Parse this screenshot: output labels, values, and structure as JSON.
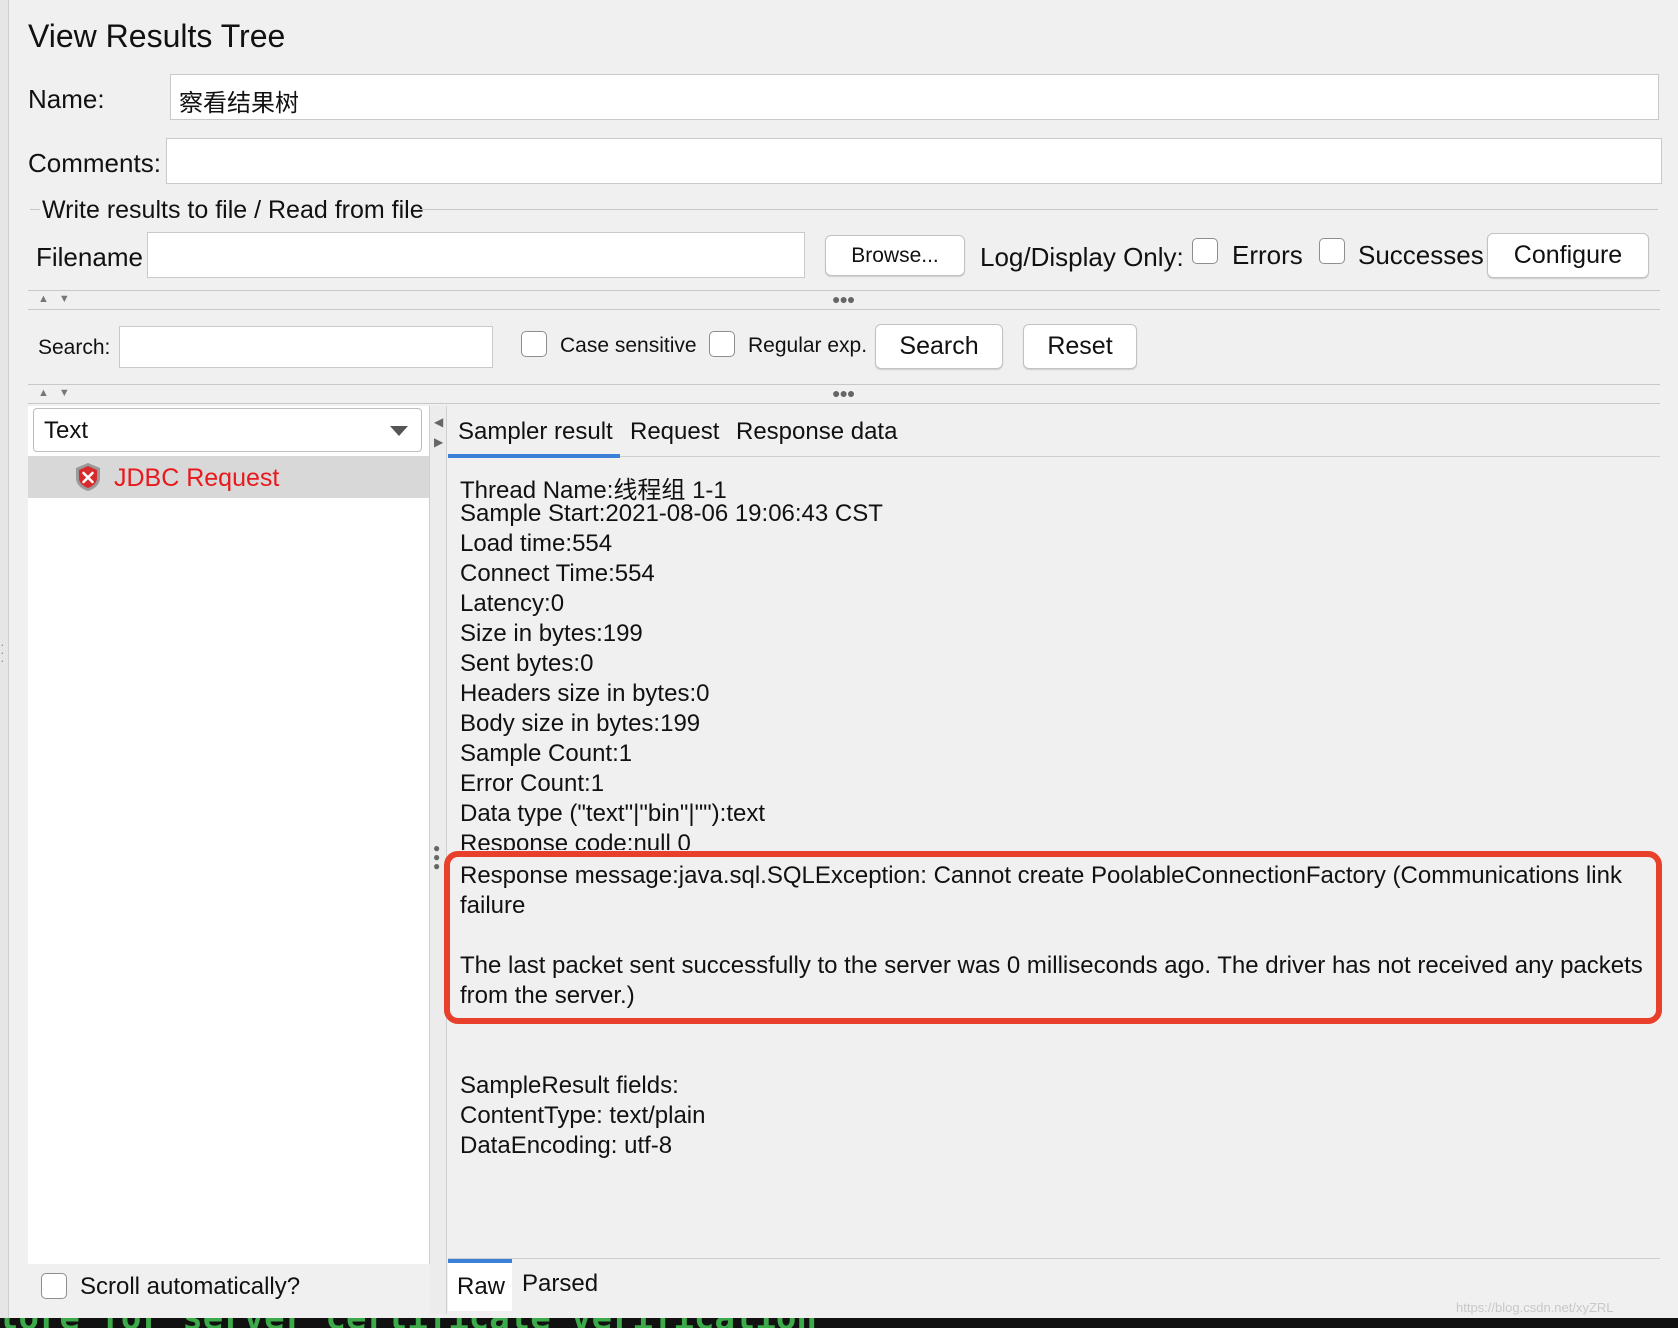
{
  "window": {
    "title": "View Results Tree"
  },
  "form": {
    "name_label": "Name:",
    "name_value": "察看结果树",
    "comments_label": "Comments:",
    "comments_value": "",
    "file_section_title": "Write results to file / Read from file",
    "filename_label": "Filename",
    "filename_value": "",
    "browse_label": "Browse...",
    "log_display_label": "Log/Display Only:",
    "errors_label": "Errors",
    "successes_label": "Successes",
    "configure_label": "Configure"
  },
  "search": {
    "label": "Search:",
    "value": "",
    "case_sensitive_label": "Case sensitive",
    "regex_label": "Regular exp.",
    "search_button": "Search",
    "reset_button": "Reset"
  },
  "tree": {
    "renderer_selected": "Text",
    "items": [
      {
        "label": "JDBC Request",
        "status": "error"
      }
    ],
    "scroll_auto_label": "Scroll automatically?"
  },
  "tabs": {
    "sampler_result": "Sampler result",
    "request": "Request",
    "response_data": "Response data"
  },
  "result": {
    "lines": [
      "Thread Name:线程组 1-1",
      "Sample Start:2021-08-06 19:06:43 CST",
      "Load time:554",
      "Connect Time:554",
      "Latency:0",
      "Size in bytes:199",
      "Sent bytes:0",
      "Headers size in bytes:0",
      "Body size in bytes:199",
      "Sample Count:1",
      "Error Count:1",
      "Data type (\"text\"|\"bin\"|\"\"):text",
      "Response code:null 0"
    ],
    "response_message_1": "Response message:java.sql.SQLException: Cannot create PoolableConnectionFactory (Communications link",
    "response_message_2": "failure",
    "response_message_3": "The last packet sent successfully to the server was 0 milliseconds ago. The driver has not received any packets",
    "response_message_4": "from the server.)",
    "fields_title": "SampleResult fields:",
    "content_type": "ContentType: text/plain",
    "data_encoding": "DataEncoding: utf-8"
  },
  "bottom_tabs": {
    "raw": "Raw",
    "parsed": "Parsed"
  },
  "watermark": "https://blog.csdn.net/xyZRL",
  "terminal_text": "tore for server certificate verification",
  "colors": {
    "error_text": "#e8191d",
    "highlight_box": "#e8402a",
    "tab_underline": "#3c7fd6",
    "terminal_text": "#3daa4a"
  }
}
